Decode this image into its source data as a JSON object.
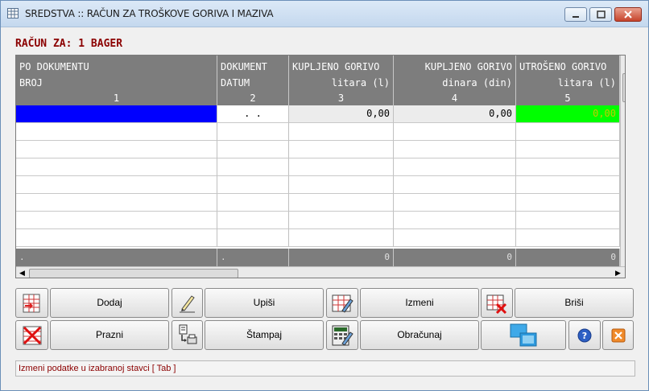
{
  "window": {
    "title": "SREDSTVA :: RAČUN ZA TROŠKOVE GORIVA I MAZIVA"
  },
  "heading": "RAČUN ZA: 1 BAGER",
  "grid": {
    "columns": [
      {
        "line1": "PO DOKUMENTU",
        "line2": "BROJ",
        "num": "1"
      },
      {
        "line1": "DOKUMENT",
        "line2": "DATUM",
        "num": "2"
      },
      {
        "line1": "KUPLJENO GORIVO",
        "line2": "litara (l)",
        "num": "3"
      },
      {
        "line1": "KUPLJENO GORIVO",
        "line2": "dinara (din)",
        "num": "4"
      },
      {
        "line1": "UTROŠENO GORIVO",
        "line2": "litara (l)",
        "num": "5"
      }
    ],
    "first_row": {
      "date": ". .",
      "bought_liters": "0,00",
      "bought_dinars": "0,00",
      "used_liters": "0,00"
    },
    "footer": [
      ".",
      ".",
      "0",
      "0",
      "0"
    ]
  },
  "buttons": {
    "dodaj": "Dodaj",
    "upisi": "Upiši",
    "izmeni": "Izmeni",
    "brisi": "Briši",
    "prazni": "Prazni",
    "stampaj": "Štampaj",
    "obracunaj": "Obračunaj"
  },
  "status": "Izmeni podatke u izabranoj stavci [ Tab ]",
  "colors": {
    "selected_cell": "#0000ff",
    "used_fuel_cell": "#00ff00",
    "header_bg": "#7d7d7d",
    "heading": "#8b0000"
  }
}
